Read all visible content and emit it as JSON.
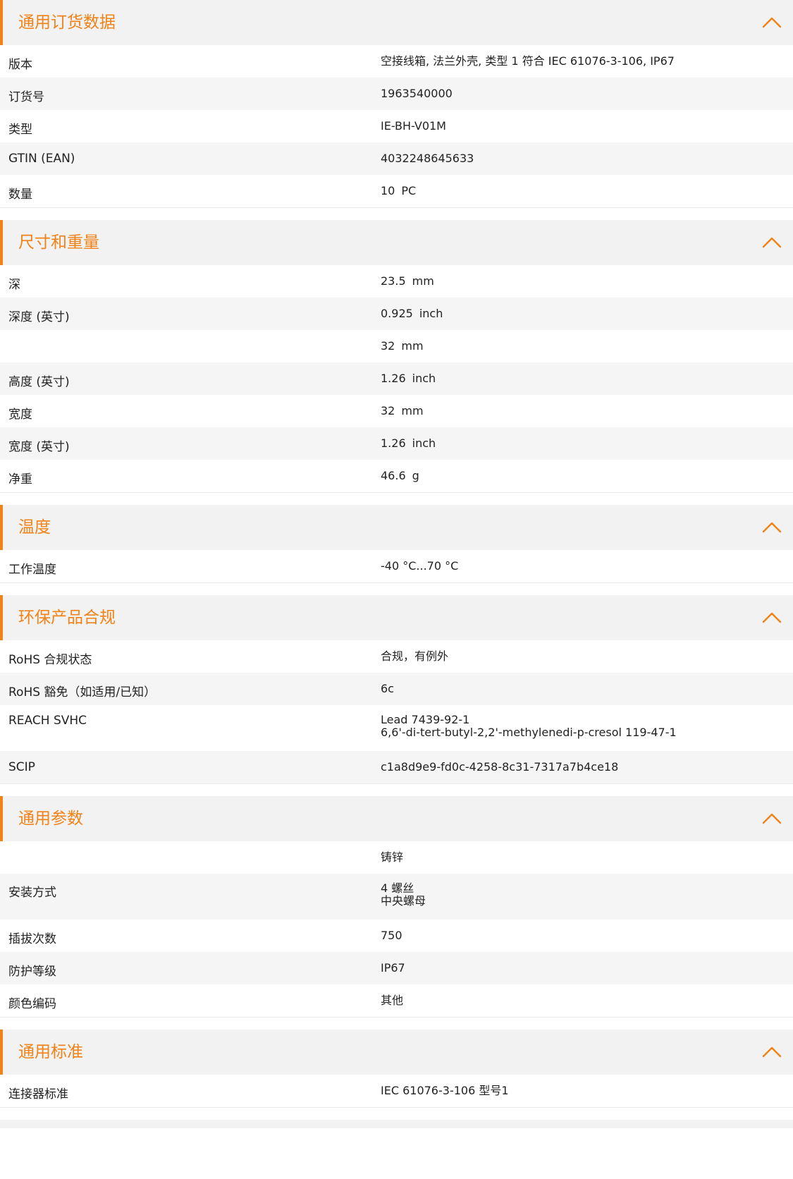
{
  "colors": {
    "accent": "#f08217",
    "header_bg": "#f2f2f2",
    "alt_row_bg": "#f5f5f5",
    "text": "#222222"
  },
  "toggle_icon": "chevron-up-icon",
  "sections": [
    {
      "id": "general-ordering",
      "title": "通用订货数据",
      "rows": [
        {
          "label": "版本",
          "lines": [
            "空接线箱, 法兰外壳, 类型 1 符合 IEC 61076-3-106, IP67"
          ]
        },
        {
          "label": "订货号",
          "lines": [
            "1963540000"
          ]
        },
        {
          "label": "类型",
          "lines": [
            "IE-BH-V01M"
          ]
        },
        {
          "label": "GTIN (EAN)",
          "lines": [
            "4032248645633"
          ]
        },
        {
          "label": "数量",
          "value": "10",
          "unit": "PC"
        }
      ]
    },
    {
      "id": "dimensions-weight",
      "title": "尺寸和重量",
      "rows": [
        {
          "label": "深",
          "value": "23.5",
          "unit": "mm"
        },
        {
          "label": "深度 (英寸)",
          "value": "0.925",
          "unit": "inch"
        },
        {
          "label": "",
          "value": "32",
          "unit": "mm"
        },
        {
          "label": "高度 (英寸)",
          "value": "1.26",
          "unit": "inch"
        },
        {
          "label": "宽度",
          "value": "32",
          "unit": "mm"
        },
        {
          "label": "宽度 (英寸)",
          "value": "1.26",
          "unit": "inch"
        },
        {
          "label": "净重",
          "value": "46.6",
          "unit": "g"
        }
      ]
    },
    {
      "id": "temperature",
      "title": "温度",
      "rows": [
        {
          "label": "工作温度",
          "lines": [
            "-40 °C...70 °C"
          ]
        }
      ]
    },
    {
      "id": "environmental-compliance",
      "title": "环保产品合规",
      "rows": [
        {
          "label": "RoHS 合规状态",
          "lines": [
            "合规，有例外"
          ]
        },
        {
          "label": "RoHS 豁免（如适用/已知）",
          "lines": [
            "6c"
          ]
        },
        {
          "label": "REACH SVHC",
          "lines": [
            "Lead 7439-92-1",
            "6,6'-di-tert-butyl-2,2'-methylenedi-p-cresol 119-47-1"
          ]
        },
        {
          "label": "SCIP",
          "lines": [
            "c1a8d9e9-fd0c-4258-8c31-7317a7b4ce18"
          ]
        }
      ]
    },
    {
      "id": "general-parameters",
      "title": "通用参数",
      "rows": [
        {
          "label": "",
          "lines": [
            "铸锌"
          ]
        },
        {
          "label": "安装方式",
          "lines": [
            "4 螺丝",
            "中央螺母"
          ]
        },
        {
          "label": "插拔次数",
          "lines": [
            "750"
          ]
        },
        {
          "label": "防护等级",
          "lines": [
            "IP67"
          ]
        },
        {
          "label": "颜色编码",
          "lines": [
            "其他"
          ]
        }
      ]
    },
    {
      "id": "general-standards",
      "title": "通用标准",
      "rows": [
        {
          "label": "连接器标准",
          "lines": [
            "IEC 61076-3-106 型号1"
          ]
        }
      ]
    }
  ]
}
